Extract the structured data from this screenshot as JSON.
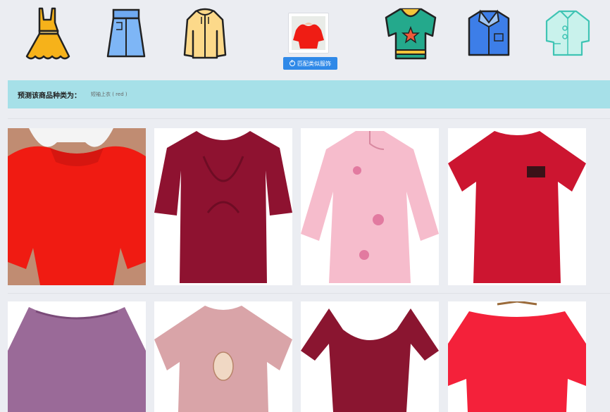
{
  "category_icons": [
    {
      "name": "dress-icon"
    },
    {
      "name": "skirt-icon"
    },
    {
      "name": "jacket-icon"
    },
    {
      "name": "tshirt-icon"
    },
    {
      "name": "shirt-icon"
    },
    {
      "name": "chinese-top-icon"
    }
  ],
  "match_button": {
    "label": "匹配类似服饰"
  },
  "prediction": {
    "label": "预测该商品种类为：",
    "value": "短袖上衣 ( red )"
  },
  "results": [
    {
      "name": "red-blouse",
      "color": "#f01b12"
    },
    {
      "name": "maroon-twist-top",
      "color": "#8e1230"
    },
    {
      "name": "pink-qipao-top",
      "color": "#f6bccc"
    },
    {
      "name": "red-tshirt",
      "color": "#cc1530"
    },
    {
      "name": "purple-top",
      "color": "#9a6a98"
    },
    {
      "name": "pink-tee",
      "color": "#d9a4a8"
    },
    {
      "name": "maroon-knit-top",
      "color": "#8a1530"
    },
    {
      "name": "red-chiffon-top",
      "color": "#f4213a"
    }
  ]
}
